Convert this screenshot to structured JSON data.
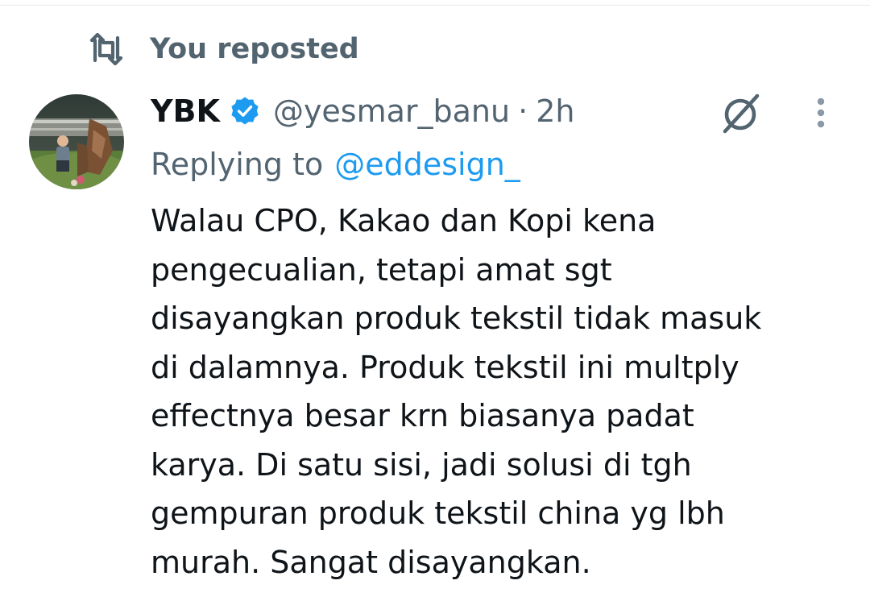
{
  "repost": {
    "label": "You reposted",
    "icon": "repost-icon"
  },
  "author": {
    "display_name": "YBK",
    "verified_icon": "verified-badge-icon",
    "handle": "@yesmar_banu",
    "separator": "·",
    "time": "2h"
  },
  "reply": {
    "prefix": "Replying to",
    "to": "@eddesign_"
  },
  "tweet": {
    "lines": [
      "Walau CPO, Kakao dan Kopi kena",
      "pengecualian, tetapi amat sgt",
      "disayangkan produk tekstil tidak masuk",
      "di dalamnya. Produk tekstil ini multply",
      "effectnya besar krn biasanya padat",
      "karya. Di satu sisi, jadi solusi di tgh",
      "gempuran produk tekstil china yg lbh",
      "murah. Sangat disayangkan."
    ]
  },
  "icons": {
    "grok": "grok-icon",
    "more": "more-options-icon"
  },
  "colors": {
    "text_primary": "#0f1419",
    "text_secondary": "#536471",
    "accent_blue": "#1d9bf0"
  }
}
